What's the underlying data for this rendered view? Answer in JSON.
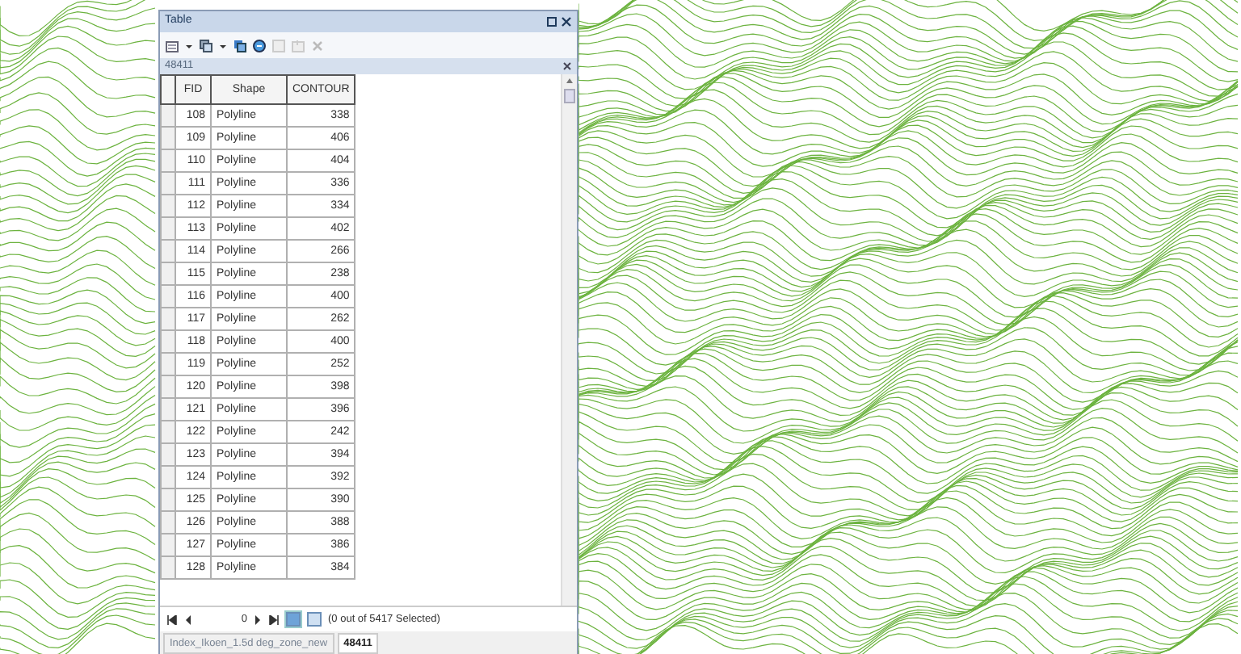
{
  "window": {
    "title": "Table"
  },
  "table_tab": {
    "label": "48411"
  },
  "table": {
    "columns": [
      "FID",
      "Shape",
      "CONTOUR"
    ],
    "rows": [
      [
        "108",
        "Polyline",
        "338"
      ],
      [
        "109",
        "Polyline",
        "406"
      ],
      [
        "110",
        "Polyline",
        "404"
      ],
      [
        "111",
        "Polyline",
        "336"
      ],
      [
        "112",
        "Polyline",
        "334"
      ],
      [
        "113",
        "Polyline",
        "402"
      ],
      [
        "114",
        "Polyline",
        "266"
      ],
      [
        "115",
        "Polyline",
        "238"
      ],
      [
        "116",
        "Polyline",
        "400"
      ],
      [
        "117",
        "Polyline",
        "262"
      ],
      [
        "118",
        "Polyline",
        "400"
      ],
      [
        "119",
        "Polyline",
        "252"
      ],
      [
        "120",
        "Polyline",
        "398"
      ],
      [
        "121",
        "Polyline",
        "396"
      ],
      [
        "122",
        "Polyline",
        "242"
      ],
      [
        "123",
        "Polyline",
        "394"
      ],
      [
        "124",
        "Polyline",
        "392"
      ],
      [
        "125",
        "Polyline",
        "390"
      ],
      [
        "126",
        "Polyline",
        "388"
      ],
      [
        "127",
        "Polyline",
        "386"
      ],
      [
        "128",
        "Polyline",
        "384"
      ]
    ]
  },
  "navigator": {
    "record": "0",
    "views": [
      {
        "selected": true
      },
      {
        "selected": false
      }
    ],
    "status": "(0 out of 5417 Selected)"
  },
  "bottom_tabs": [
    {
      "label": "Index_Ikoen_1.5d deg_zone_new",
      "selected": false
    },
    {
      "label": "48411",
      "selected": true
    }
  ]
}
